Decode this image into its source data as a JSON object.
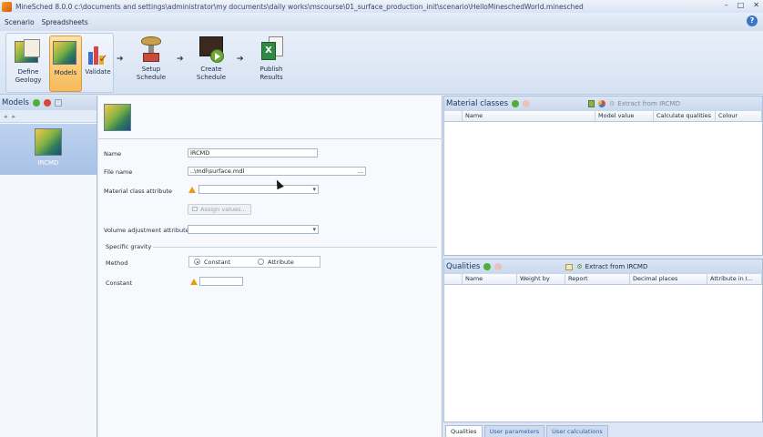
{
  "window": {
    "title": "MineSched 8.0.0     c:\\documents and settings\\administrator\\my documents\\daily works\\mscourse\\01_surface_production_init\\scenario\\HelloMineschedWorld.minesched",
    "minimize": "–",
    "maximize": "□",
    "close": "✕"
  },
  "menu": {
    "scenario": "Scenario",
    "spreadsheets": "Spreadsheets",
    "help": "?"
  },
  "ribbon": {
    "define_geology": "Define\nGeology",
    "models": "Models",
    "validate": "Validate",
    "setup_schedule": "Setup\nSchedule",
    "create_schedule": "Create\nSchedule",
    "publish_results": "Publish\nResults"
  },
  "models_panel": {
    "title": "Models",
    "item_label": "IRCMD"
  },
  "form": {
    "name_label": "Name",
    "name_value": "IRCMD",
    "file_label": "File name",
    "file_value": "..\\mdl\\surface.mdl",
    "file_browse": "...",
    "material_label": "Material class attribute",
    "material_value": "",
    "assign_button": "Assign values...",
    "volume_label": "Volume adjustment attribute",
    "volume_value": "",
    "gravity_header": "Specific gravity",
    "method_label": "Method",
    "constant_option": "Constant",
    "attribute_option": "Attribute",
    "constant_label": "Constant",
    "constant_value": ""
  },
  "material_classes": {
    "title": "Material classes",
    "extract": "Extract from IRCMD",
    "columns": [
      "Name",
      "Model value",
      "Calculate qualities",
      "Colour"
    ]
  },
  "qualities": {
    "title": "Qualities",
    "extract": "Extract from IRCMD",
    "columns": [
      "Name",
      "Weight by",
      "Report",
      "Decimal places",
      "Attribute in I..."
    ]
  },
  "bottom_tabs": [
    "Qualities",
    "User parameters",
    "User calculations"
  ]
}
